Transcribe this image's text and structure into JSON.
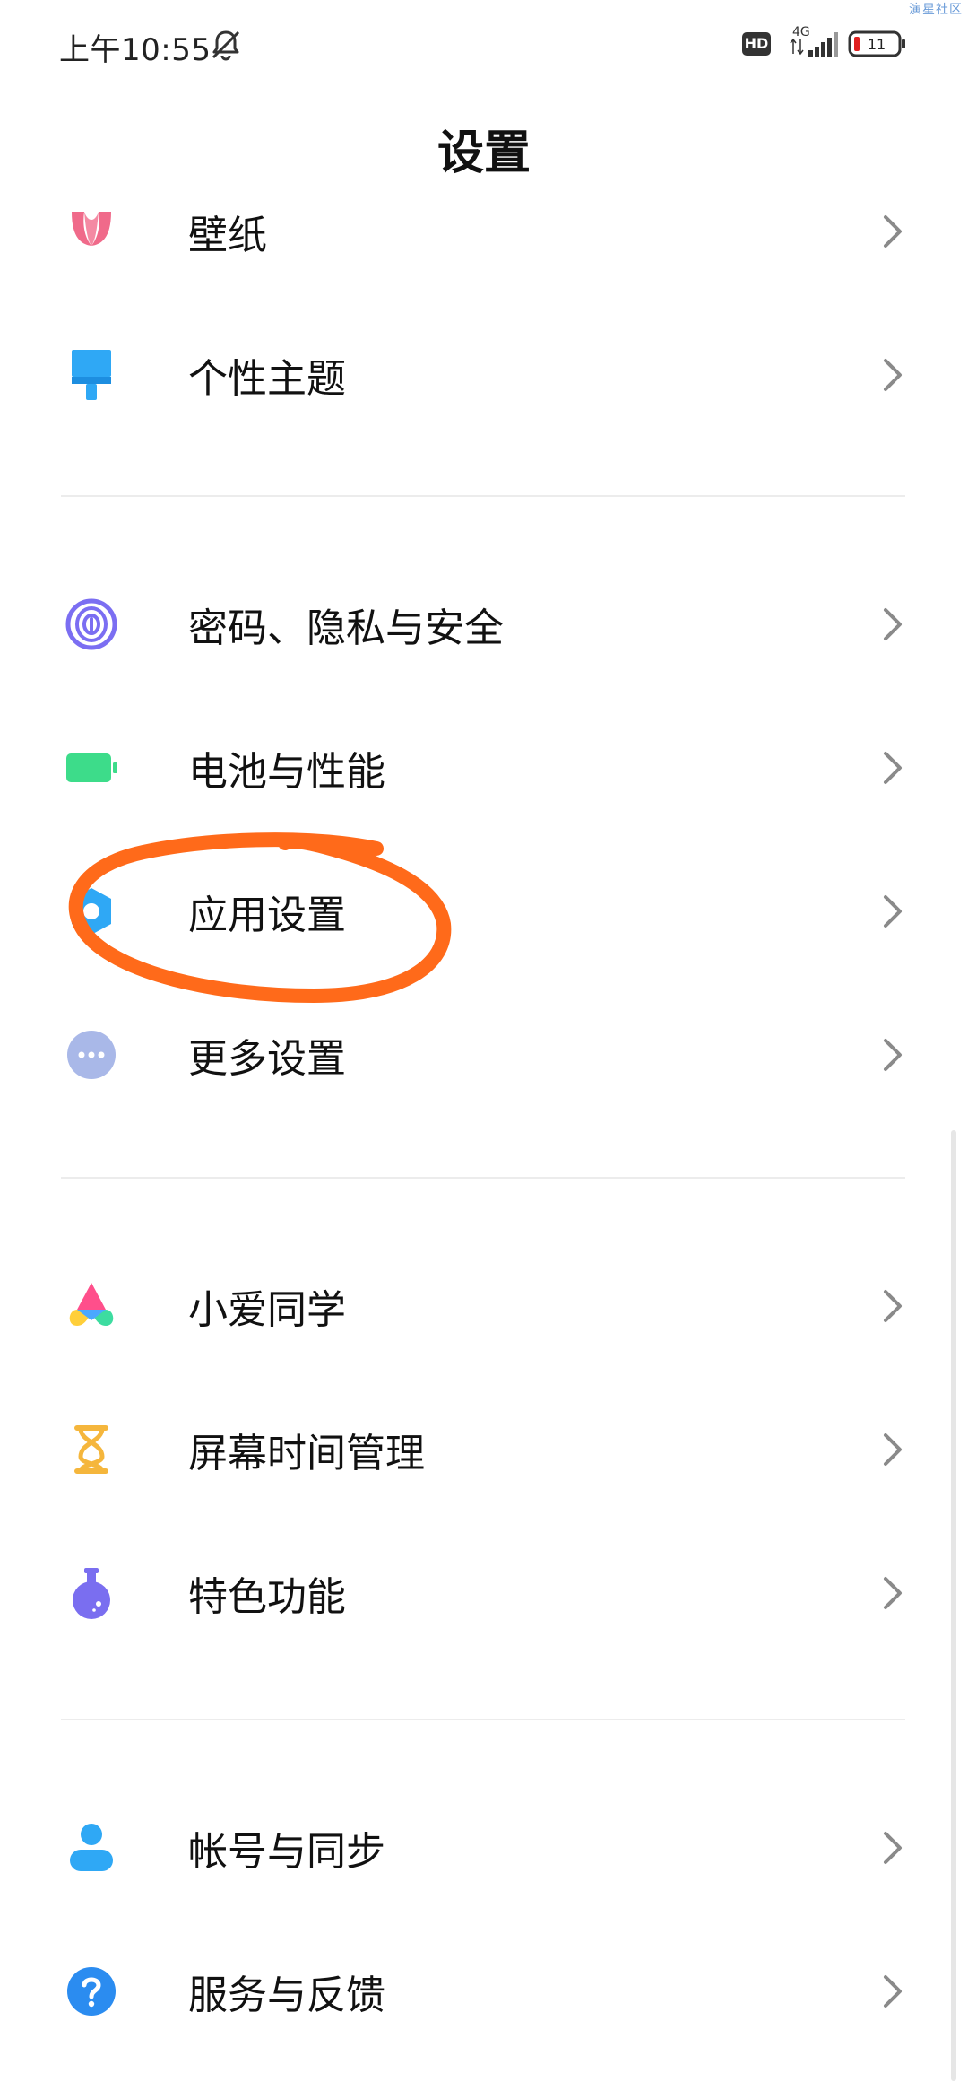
{
  "watermark": "演星社区",
  "status_bar": {
    "time": "上午10:55",
    "hd_badge": "HD",
    "network": "4G",
    "battery_level": "11"
  },
  "header": {
    "title": "设置"
  },
  "sections": [
    {
      "items": [
        {
          "label": "壁纸",
          "icon": "wallpaper-icon",
          "color": "#f06a8a"
        },
        {
          "label": "个性主题",
          "icon": "theme-brush-icon",
          "color": "#2fa8f5"
        }
      ]
    },
    {
      "items": [
        {
          "label": "密码、隐私与安全",
          "icon": "fingerprint-icon",
          "color": "#7b6ef2"
        },
        {
          "label": "电池与性能",
          "icon": "battery-icon",
          "color": "#3ddc8a"
        },
        {
          "label": "应用设置",
          "icon": "app-settings-icon",
          "color": "#2fa8f5"
        },
        {
          "label": "更多设置",
          "icon": "more-dots-icon",
          "color": "#a9b8e8"
        }
      ]
    },
    {
      "items": [
        {
          "label": "小爱同学",
          "icon": "xiaoai-icon",
          "color": "#ff4f8b"
        },
        {
          "label": "屏幕时间管理",
          "icon": "hourglass-icon",
          "color": "#f5b63c"
        },
        {
          "label": "特色功能",
          "icon": "flask-icon",
          "color": "#7a6ef0"
        }
      ]
    },
    {
      "items": [
        {
          "label": "帐号与同步",
          "icon": "account-icon",
          "color": "#2fa8f5"
        },
        {
          "label": "服务与反馈",
          "icon": "help-icon",
          "color": "#2b8cf0"
        }
      ]
    }
  ],
  "annotation": {
    "color": "#ff6a1a",
    "target": "应用设置"
  }
}
